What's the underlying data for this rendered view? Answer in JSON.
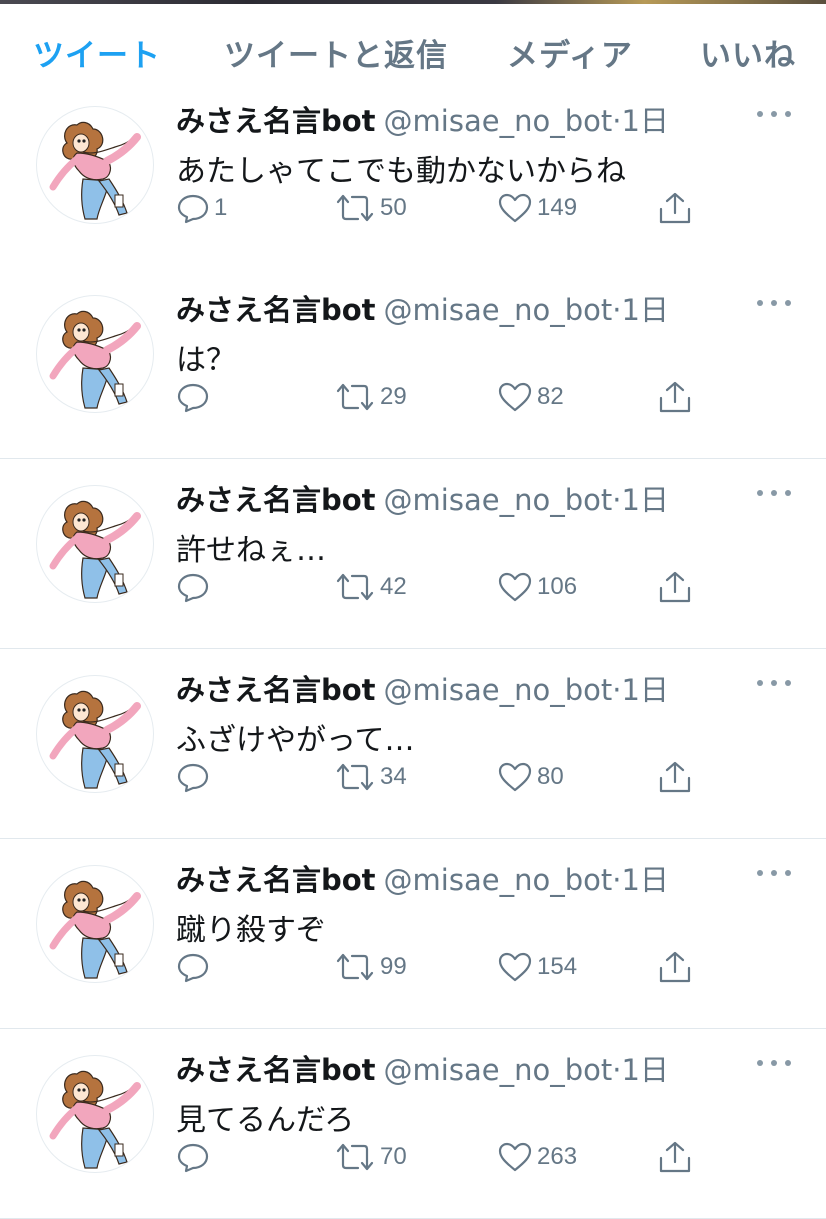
{
  "tabs": [
    {
      "label": "ツイート",
      "active": true
    },
    {
      "label": "ツイートと返信",
      "active": false
    },
    {
      "label": "メディア",
      "active": false
    },
    {
      "label": "いいね",
      "active": false
    }
  ],
  "accent_color": "#1da1f2",
  "icons": {
    "reply": "speech-bubble-icon",
    "retweet": "retweet-arrows-icon",
    "like": "heart-icon",
    "share": "share-upload-icon",
    "more": "more-dots-icon"
  },
  "tweets": [
    {
      "name": "みさえ名言bot",
      "handle": "@misae_no_bot",
      "separator": "·",
      "time": "1日",
      "text": "あたしゃてこでも動かないからね",
      "replies": "1",
      "retweets": "50",
      "likes": "149"
    },
    {
      "name": "みさえ名言bot",
      "handle": "@misae_no_bot",
      "separator": "·",
      "time": "1日",
      "text": "は？",
      "replies": "",
      "retweets": "29",
      "likes": "82"
    },
    {
      "name": "みさえ名言bot",
      "handle": "@misae_no_bot",
      "separator": "·",
      "time": "1日",
      "text": "許せねぇ…",
      "replies": "",
      "retweets": "42",
      "likes": "106"
    },
    {
      "name": "みさえ名言bot",
      "handle": "@misae_no_bot",
      "separator": "·",
      "time": "1日",
      "text": "ふざけやがって…",
      "replies": "",
      "retweets": "34",
      "likes": "80"
    },
    {
      "name": "みさえ名言bot",
      "handle": "@misae_no_bot",
      "separator": "·",
      "time": "1日",
      "text": "蹴り殺すぞ",
      "replies": "",
      "retweets": "99",
      "likes": "154"
    },
    {
      "name": "みさえ名言bot",
      "handle": "@misae_no_bot",
      "separator": "·",
      "time": "1日",
      "text": "見てるんだろ",
      "replies": "",
      "retweets": "70",
      "likes": "263"
    }
  ]
}
